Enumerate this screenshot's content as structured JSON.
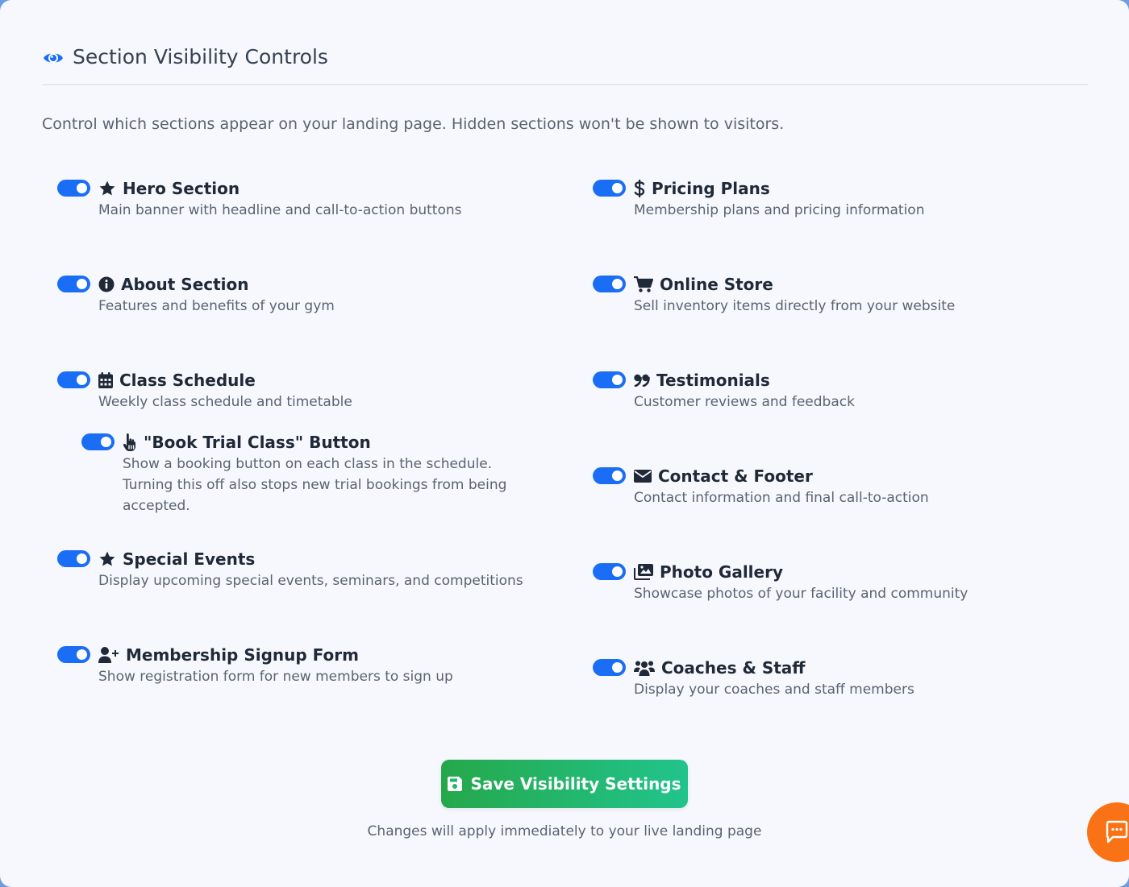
{
  "header": {
    "title": "Section Visibility Controls",
    "intro": "Control which sections appear on your landing page. Hidden sections won't be shown to visitors."
  },
  "sections": {
    "hero": {
      "title": "Hero Section",
      "desc": "Main banner with headline and call-to-action buttons",
      "icon": "star-icon",
      "enabled": true
    },
    "about": {
      "title": "About Section",
      "desc": "Features and benefits of your gym",
      "icon": "info-circle-icon",
      "enabled": true
    },
    "schedule": {
      "title": "Class Schedule",
      "desc": "Weekly class schedule and timetable",
      "icon": "calendar-icon",
      "enabled": true
    },
    "trial": {
      "title": "\"Book Trial Class\" Button",
      "desc": "Show a booking button on each class in the schedule. Turning this off also stops new trial bookings from being accepted.",
      "icon": "hand-pointer-icon",
      "enabled": true
    },
    "events": {
      "title": "Special Events",
      "desc": "Display upcoming special events, seminars, and competitions",
      "icon": "star-icon",
      "enabled": true
    },
    "signup": {
      "title": "Membership Signup Form",
      "desc": "Show registration form for new members to sign up",
      "icon": "user-plus-icon",
      "enabled": true
    },
    "pricing": {
      "title": "Pricing Plans",
      "desc": "Membership plans and pricing information",
      "icon": "dollar-icon",
      "enabled": true
    },
    "store": {
      "title": "Online Store",
      "desc": "Sell inventory items directly from your website",
      "icon": "shopping-cart-icon",
      "enabled": true
    },
    "testimonials": {
      "title": "Testimonials",
      "desc": "Customer reviews and feedback",
      "icon": "quote-icon",
      "enabled": true
    },
    "contact": {
      "title": "Contact & Footer",
      "desc": "Contact information and final call-to-action",
      "icon": "envelope-icon",
      "enabled": true
    },
    "gallery": {
      "title": "Photo Gallery",
      "desc": "Showcase photos of your facility and community",
      "icon": "images-icon",
      "enabled": true
    },
    "coaches": {
      "title": "Coaches & Staff",
      "desc": "Display your coaches and staff members",
      "icon": "users-icon",
      "enabled": true
    }
  },
  "actions": {
    "save_label": "Save Visibility Settings",
    "note": "Changes will apply immediately to your live landing page"
  },
  "colors": {
    "toggle_on": "#1a6ef5",
    "accent_blue": "#1a6ef5",
    "save_start": "#25a84b",
    "save_end": "#21c48d",
    "chat": "#f97316"
  }
}
